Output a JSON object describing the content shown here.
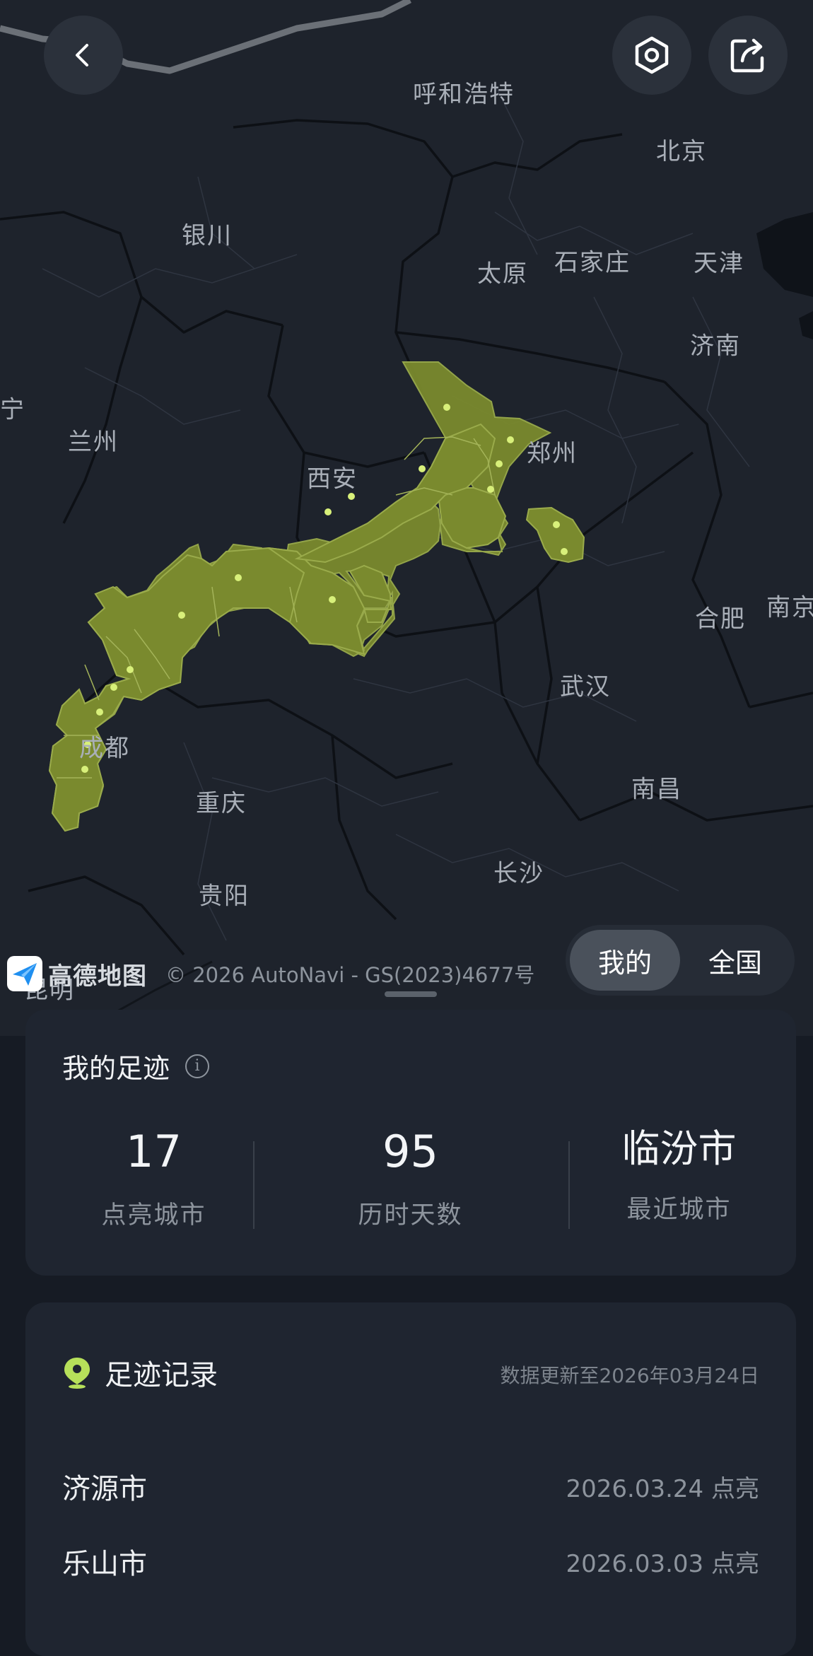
{
  "map": {
    "city_labels": [
      "呼和浩特",
      "北京",
      "银川",
      "太原",
      "石家庄",
      "天津",
      "济南",
      "宁",
      "兰州",
      "郑州",
      "西安",
      "合肥",
      "南京",
      "武汉",
      "成都",
      "重庆",
      "南昌",
      "长沙",
      "贵阳",
      "昆明"
    ],
    "attribution_logo": "高德地图",
    "attribution_copyright": "© 2026 AutoNavi - GS(2023)4677号",
    "highlight_color": "#7a8a2e",
    "dot_color": "#d8f07a"
  },
  "toolbar": {
    "back_icon": "chevron-left-icon",
    "settings_icon": "hexagon-settings-icon",
    "share_icon": "share-icon"
  },
  "toggle": {
    "mine": "我的",
    "all": "全国",
    "selected": "我的"
  },
  "summary": {
    "title": "我的足迹",
    "info_glyph": "i",
    "stats": [
      {
        "value": "17",
        "label": "点亮城市"
      },
      {
        "value": "95",
        "label": "历时天数"
      },
      {
        "value": "临汾市",
        "label": "最近城市"
      }
    ]
  },
  "records": {
    "title": "足迹记录",
    "updated": "数据更新至2026年03月24日",
    "items": [
      {
        "city": "济源市",
        "date": "2026.03.24 点亮"
      },
      {
        "city": "乐山市",
        "date": "2026.03.03 点亮"
      }
    ]
  }
}
